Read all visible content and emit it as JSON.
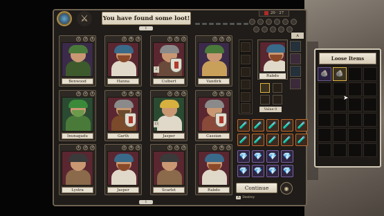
{
  "header": {
    "title": "You have found some loot!",
    "page_top": "1",
    "page_bottom": "1",
    "counter": "20 · 27"
  },
  "characters": [
    {
      "name": "Benwood",
      "stats": [
        "2",
        "3",
        "1"
      ],
      "bg": "#3b2a4a",
      "hat": "#4a7a3a",
      "body": "#3d5a2c",
      "beard": "#c99873",
      "shield": false,
      "level": ""
    },
    {
      "name": "Hanna",
      "stats": [
        "2",
        "4",
        "3"
      ],
      "bg": "#5a2630",
      "hat": "#3a6a8a",
      "body": "#e0d8c8",
      "beard": "#8a4a2a",
      "shield": false,
      "level": ""
    },
    {
      "name": "Culbert",
      "stats": [
        "1",
        "5",
        "2"
      ],
      "bg": "#5a2630",
      "hat": "#8a8a8a",
      "body": "#6a4a3a",
      "beard": "#c99873",
      "shield": true,
      "level": "2"
    },
    {
      "name": "Vandirk",
      "stats": [
        "2",
        "3",
        "2"
      ],
      "bg": "#3b2a4a",
      "hat": "#4a7a3a",
      "body": "#c9a05a",
      "beard": "#c99873",
      "shield": false,
      "level": ""
    },
    {
      "name": "Inunagadu",
      "stats": [
        "3",
        "2",
        "1"
      ],
      "bg": "#2a4a32",
      "hat": "#3a8a3a",
      "body": "#4a7a3a",
      "beard": "#6a9a4a",
      "shield": false,
      "level": ""
    },
    {
      "name": "Garth",
      "stats": [
        "1",
        "4",
        "4"
      ],
      "bg": "#5a2630",
      "hat": "#8a8a8a",
      "body": "#7a4a2a",
      "beard": "#6a4a2a",
      "shield": true,
      "level": ""
    },
    {
      "name": "Jasper",
      "stats": [
        "2",
        "3",
        "3"
      ],
      "bg": "#2a4a32",
      "hat": "#d8b040",
      "body": "#e0d8c8",
      "beard": "#c99873",
      "shield": false,
      "level": "13"
    },
    {
      "name": "Cassian",
      "stats": [
        "2",
        "4",
        "2"
      ],
      "bg": "#5a2630",
      "hat": "#8a8a8a",
      "body": "#8a4a3a",
      "beard": "#c99873",
      "shield": true,
      "level": ""
    },
    {
      "name": "Lystra",
      "stats": [
        "1",
        "3",
        "3"
      ],
      "bg": "#5a2630",
      "hat": "#3a3a3a",
      "body": "#8a6a4a",
      "beard": "#c99873",
      "shield": false,
      "level": ""
    },
    {
      "name": "Jasper",
      "stats": [
        "2",
        "4",
        "3"
      ],
      "bg": "#5a2630",
      "hat": "#3a6a8a",
      "body": "#e0d8c8",
      "beard": "#8a4a2a",
      "shield": false,
      "level": ""
    },
    {
      "name": "Scarlet",
      "stats": [
        "1",
        "3",
        "3"
      ],
      "bg": "#5a2630",
      "hat": "#3a3a3a",
      "body": "#8a6a4a",
      "beard": "#c99873",
      "shield": false,
      "level": ""
    },
    {
      "name": "Rabdo",
      "stats": [
        "2",
        "4",
        "3"
      ],
      "bg": "#5a2630",
      "hat": "#3a6a8a",
      "body": "#e0d8c8",
      "beard": "#8a4a2a",
      "shield": false,
      "level": ""
    }
  ],
  "selected": {
    "name": "Rabdo",
    "value_label": "Value 0",
    "flag": "A"
  },
  "potions": [
    "🧪",
    "🧪",
    "🧪",
    "🧪",
    "🧪",
    "🧪",
    "🧪",
    "🧪",
    "🧪",
    "🧪"
  ],
  "gems": [
    "💎",
    "💎",
    "💎",
    "💎",
    "💎",
    "💎",
    "💎",
    "💎"
  ],
  "continue_label": "Continue",
  "key_hint": {
    "key": "X",
    "label": "Destroy"
  },
  "loose_items": {
    "title": "Loose Items",
    "items": [
      "🪨",
      "🪨"
    ]
  }
}
